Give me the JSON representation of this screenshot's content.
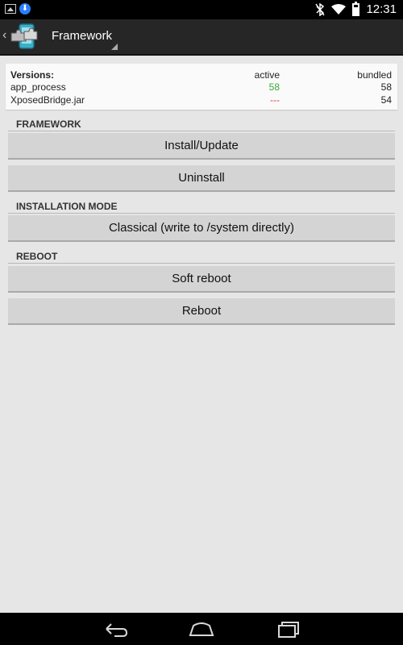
{
  "status_bar": {
    "time": "12:31",
    "icons": [
      "image-icon",
      "download-icon",
      "bluetooth-off-icon",
      "wifi-icon",
      "battery-icon"
    ]
  },
  "action_bar": {
    "title": "Framework",
    "logo_icon": "xposed-puzzle-logo-icon"
  },
  "versions": {
    "header": "Versions:",
    "col_active": "active",
    "col_bundled": "bundled",
    "rows": [
      {
        "name": "app_process",
        "active": "58",
        "bundled": "58"
      },
      {
        "name": "XposedBridge.jar",
        "active": "---",
        "bundled": "54"
      }
    ],
    "active_ok_color": "#3aa83a",
    "active_missing_color": "#e04040"
  },
  "sections": {
    "framework": "FRAMEWORK",
    "installation_mode": "INSTALLATION MODE",
    "reboot": "REBOOT"
  },
  "buttons": {
    "install_update": "Install/Update",
    "uninstall": "Uninstall",
    "classical": "Classical (write to /system directly)",
    "soft_reboot": "Soft reboot",
    "reboot": "Reboot"
  },
  "nav_bar": {
    "icons": [
      "back-icon",
      "home-icon",
      "recents-icon"
    ]
  }
}
